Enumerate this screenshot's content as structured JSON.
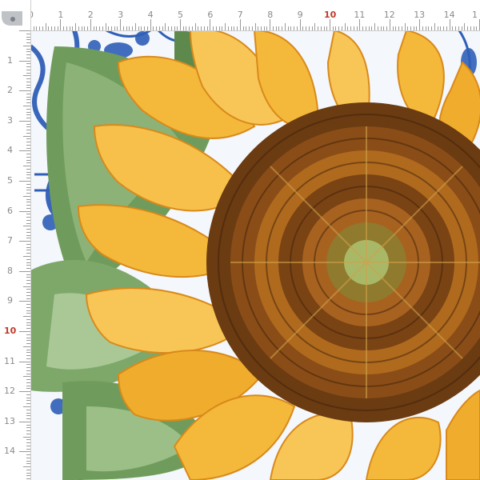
{
  "ruler": {
    "top_numbers": [
      "0",
      "1",
      "2",
      "3",
      "4",
      "5",
      "6",
      "7",
      "8",
      "9",
      "10",
      "11",
      "12",
      "13",
      "14",
      "1"
    ],
    "left_numbers": [
      "1",
      "2",
      "3",
      "4",
      "5",
      "6",
      "7",
      "8",
      "9",
      "10",
      "11",
      "12",
      "13",
      "14"
    ],
    "highlight": "10",
    "unit_color": "#8a8a8a",
    "highlight_color": "#c0392b"
  },
  "palette": {
    "tile_blue": "#2f5fb8",
    "tile_white": "#f4f7fb",
    "leaf_green": "#6f9c5c",
    "petal_yellow": "#f4b93a",
    "petal_orange": "#e08a1c",
    "seed_brown": "#6b3b12",
    "center_green": "#a9b867"
  },
  "icons": {
    "clip": "measuring-tape-clip-icon"
  }
}
